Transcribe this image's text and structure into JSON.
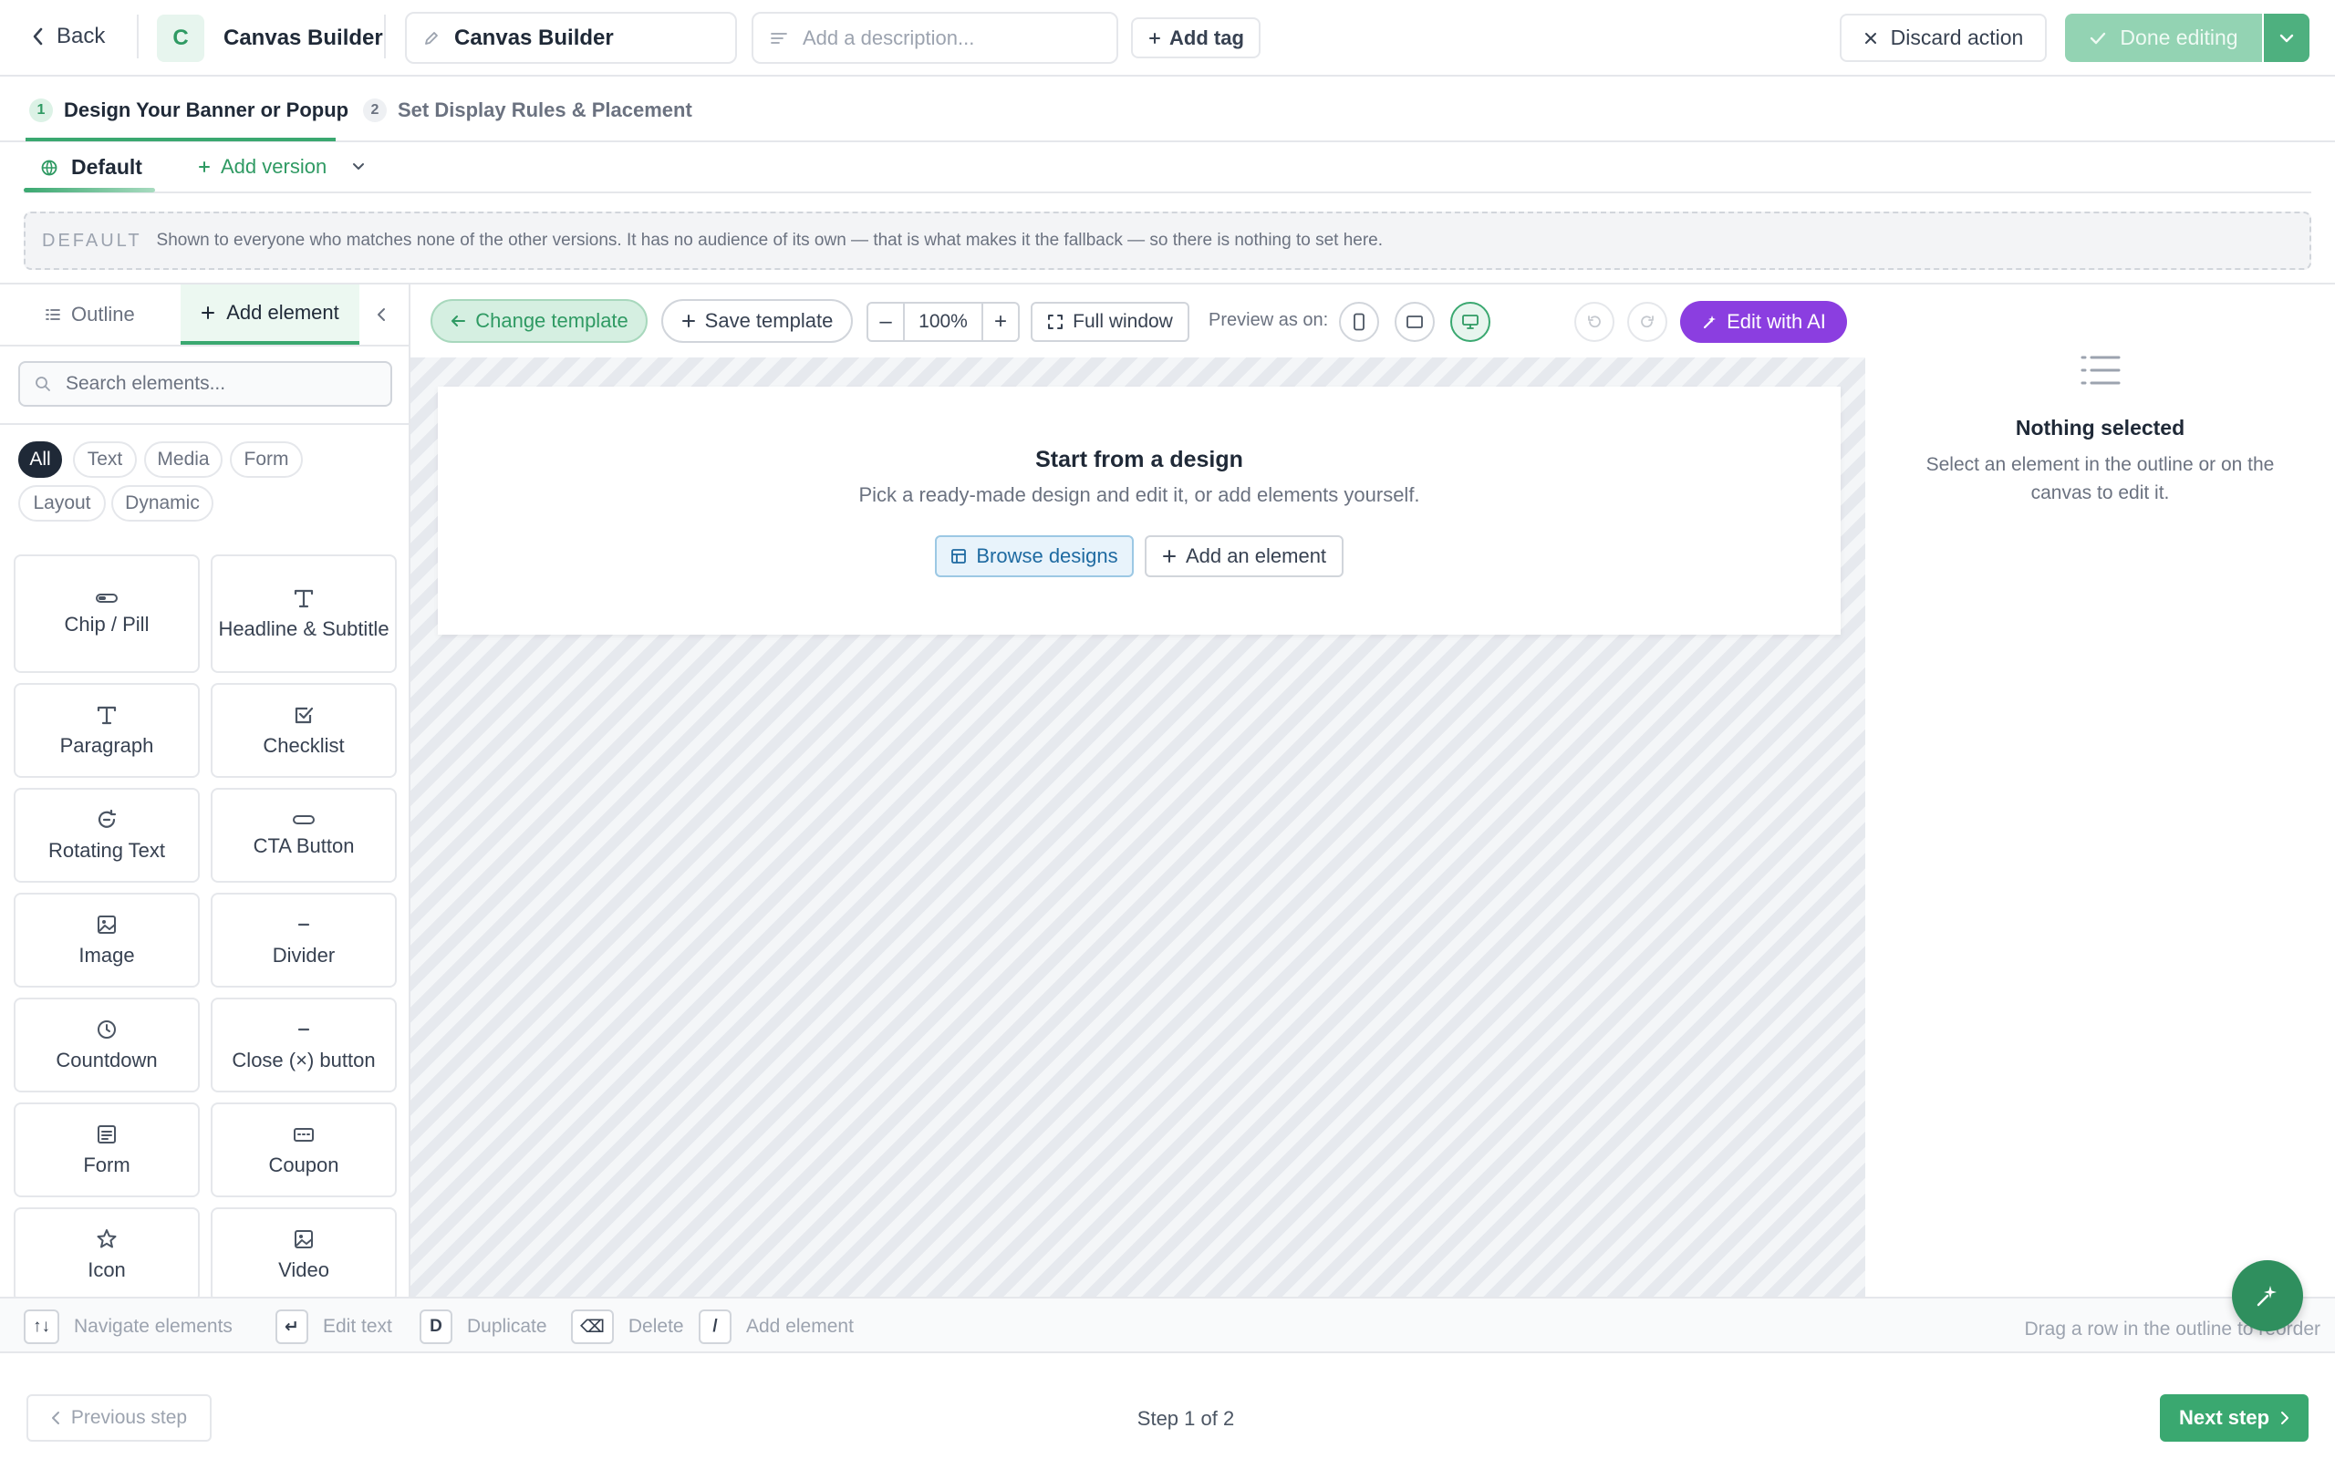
{
  "header": {
    "back_label": "Back",
    "avatar_letter": "C",
    "app_name": "Canvas Builder",
    "name_value": "Canvas Builder",
    "description_placeholder": "Add a description...",
    "add_tag_label": "Add tag",
    "discard_label": "Discard action",
    "done_label": "Done editing"
  },
  "steps": [
    {
      "num": "1",
      "label": "Design Your Banner or Popup",
      "active": true
    },
    {
      "num": "2",
      "label": "Set Display Rules & Placement",
      "active": false
    }
  ],
  "versions": {
    "default_label": "Default",
    "add_version_label": "Add version"
  },
  "default_note": {
    "tag": "DEFAULT",
    "text": "Shown to everyone who matches none of the other versions. It has no audience of its own — that is what makes it the fallback — so there is nothing to set here."
  },
  "left_panel": {
    "tabs": {
      "outline": "Outline",
      "add_element": "Add element"
    },
    "search_placeholder": "Search elements...",
    "filters": [
      "All",
      "Text",
      "Media",
      "Form",
      "Layout",
      "Dynamic"
    ],
    "active_filter": "All",
    "elements": [
      {
        "label": "Chip / Pill",
        "icon": "pill-icon"
      },
      {
        "label": "Headline & Subtitle",
        "icon": "type-icon"
      },
      {
        "label": "Paragraph",
        "icon": "type-icon"
      },
      {
        "label": "Checklist",
        "icon": "checkbox-icon"
      },
      {
        "label": "Rotating Text",
        "icon": "rotate-icon"
      },
      {
        "label": "CTA Button",
        "icon": "button-icon"
      },
      {
        "label": "Image",
        "icon": "image-icon"
      },
      {
        "label": "Divider",
        "icon": "minus-icon"
      },
      {
        "label": "Countdown",
        "icon": "clock-icon"
      },
      {
        "label": "Close (×) button",
        "icon": "minus-icon"
      },
      {
        "label": "Form",
        "icon": "form-icon"
      },
      {
        "label": "Coupon",
        "icon": "coupon-icon"
      },
      {
        "label": "Icon",
        "icon": "star-icon"
      },
      {
        "label": "Video",
        "icon": "image-icon"
      }
    ]
  },
  "toolbar": {
    "change_template": "Change template",
    "save_template": "Save template",
    "zoom_minus": "–",
    "zoom_value": "100%",
    "zoom_plus": "+",
    "full_window": "Full window",
    "preview_label": "Preview as on:",
    "active_device": "desktop",
    "edit_ai": "Edit with AI"
  },
  "canvas": {
    "title": "Start from a design",
    "subtitle": "Pick a ready-made design and edit it, or add elements yourself.",
    "browse_label": "Browse designs",
    "add_element_label": "Add an element"
  },
  "right_panel": {
    "title": "Nothing selected",
    "subtitle": "Select an element in the outline or on the canvas to edit it."
  },
  "shortcuts": {
    "items": [
      {
        "key": "↑↓",
        "label": "Navigate elements"
      },
      {
        "key": "↵",
        "label": "Edit text"
      },
      {
        "key": "D",
        "label": "Duplicate"
      },
      {
        "key": "⌫",
        "label": "Delete"
      },
      {
        "key": "/",
        "label": "Add element"
      }
    ],
    "hint": "Drag a row in the outline to reorder"
  },
  "footer": {
    "prev_label": "Previous step",
    "step_text": "Step 1 of 2",
    "next_label": "Next step"
  },
  "colors": {
    "accent_green": "#3aa870",
    "ai_purple": "#8b3ee0",
    "info_blue": "#1e6aa1"
  }
}
